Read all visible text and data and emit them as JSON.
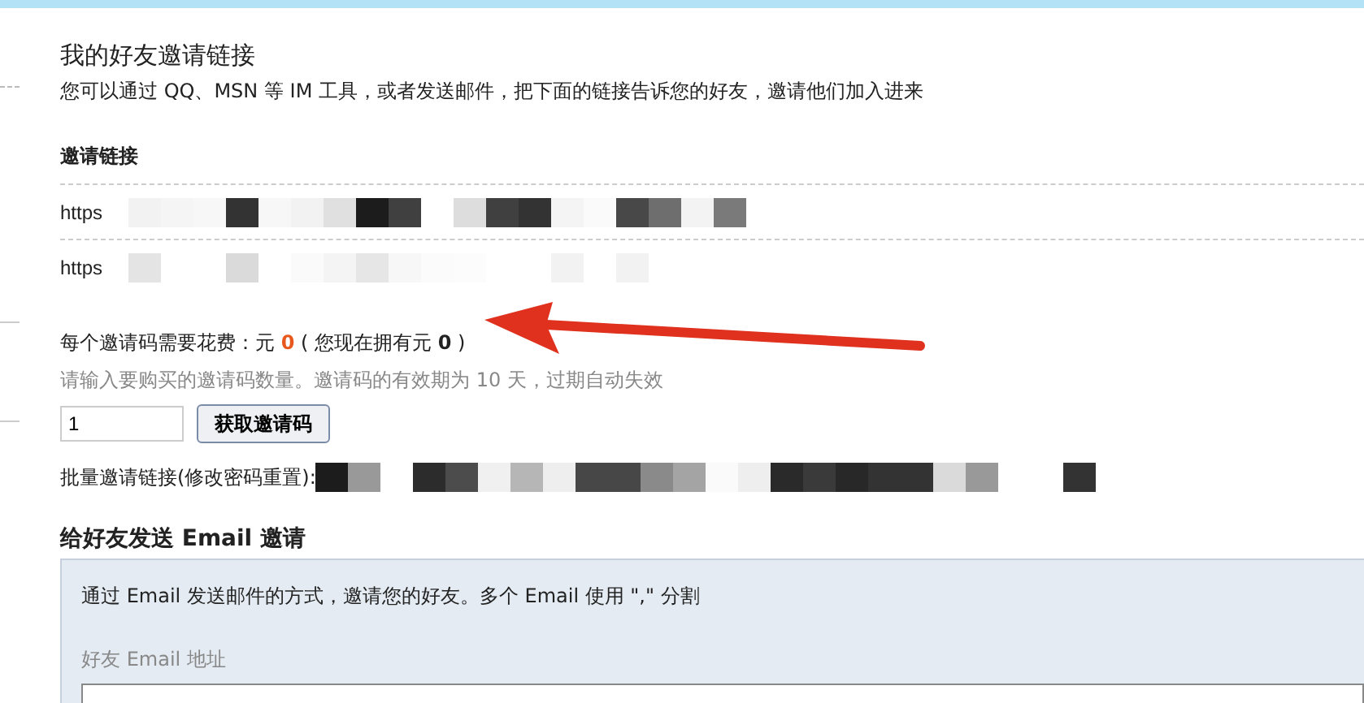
{
  "title": "我的好友邀请链接",
  "intro": "您可以通过 QQ、MSN 等 IM 工具，或者发送邮件，把下面的链接告诉您的好友，邀请他们加入进来",
  "links_heading": "邀请链接",
  "links": [
    {
      "prefix": "https"
    },
    {
      "prefix": "https"
    }
  ],
  "cost_line": {
    "label": "每个邀请码需要花费：元",
    "cost": "0",
    "middle": "( 您现在拥有元",
    "balance": "0",
    "suffix": ")"
  },
  "hint": "请输入要购买的邀请码数量。邀请码的有效期为 10 天，过期自动失效",
  "quantity": {
    "value": "1"
  },
  "buy_button": "获取邀请码",
  "batch_label": "批量邀请链接(修改密码重置):",
  "email_section": {
    "heading": "给好友发送 Email 邀请",
    "description": "通过 Email 发送邮件的方式，邀请您的好友。多个 Email 使用 \",\" 分割",
    "field_label": "好友 Email 地址"
  }
}
